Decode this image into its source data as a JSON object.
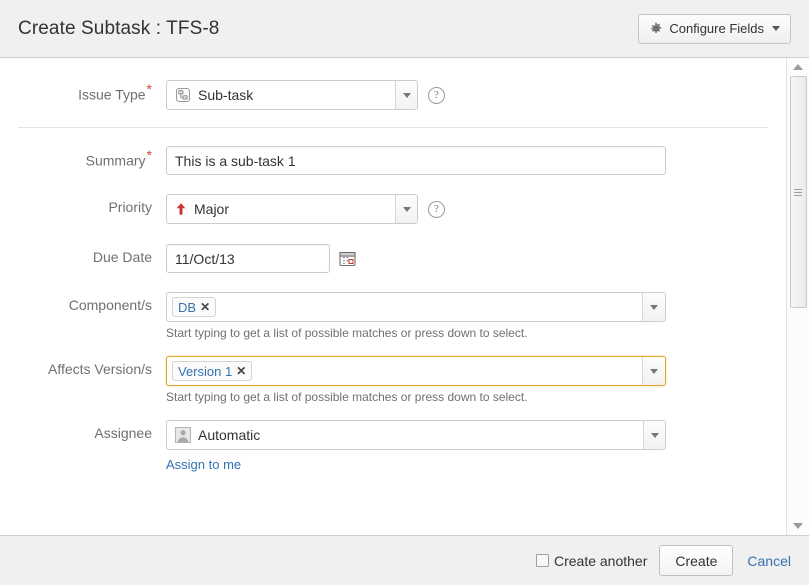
{
  "header": {
    "title": "Create Subtask : TFS-8",
    "configure_fields_label": "Configure Fields",
    "gear_icon": "gear-icon",
    "caret_icon": "chevron-down-icon"
  },
  "form": {
    "issue_type": {
      "label": "Issue Type",
      "required": true,
      "required_marker": "*",
      "value": "Sub-task",
      "icon": "sub-task-icon",
      "help_icon": "?"
    },
    "summary": {
      "label": "Summary",
      "required": true,
      "required_marker": "*",
      "value": "This is a sub-task 1"
    },
    "priority": {
      "label": "Priority",
      "required": false,
      "value": "Major",
      "icon": "priority-major-arrow-up-icon",
      "icon_color": "#cc3333",
      "help_icon": "?"
    },
    "due_date": {
      "label": "Due Date",
      "required": false,
      "value": "11/Oct/13",
      "calendar_icon": "calendar-icon"
    },
    "components": {
      "label": "Component/s",
      "required": false,
      "tags": [
        "DB"
      ],
      "remove_glyph": "✕",
      "help_text": "Start typing to get a list of possible matches or press down to select.",
      "focused": false
    },
    "affects_versions": {
      "label": "Affects Version/s",
      "required": false,
      "tags": [
        "Version 1"
      ],
      "remove_glyph": "✕",
      "help_text": "Start typing to get a list of possible matches or press down to select.",
      "focused": true
    },
    "assignee": {
      "label": "Assignee",
      "required": false,
      "value": "Automatic",
      "icon": "user-avatar-icon",
      "assign_to_me_label": "Assign to me"
    }
  },
  "footer": {
    "create_another_label": "Create another",
    "create_another_checked": false,
    "create_label": "Create",
    "cancel_label": "Cancel"
  },
  "scrollbar": {
    "up_icon": "scroll-up-arrow-icon",
    "down_icon": "scroll-down-arrow-icon",
    "thumb": "scroll-thumb"
  },
  "colors": {
    "required_star": "#d04437",
    "link": "#3572b0",
    "focus_border": "#e0a72b",
    "header_bg": "#f0f0f0",
    "label_text": "#707070"
  }
}
